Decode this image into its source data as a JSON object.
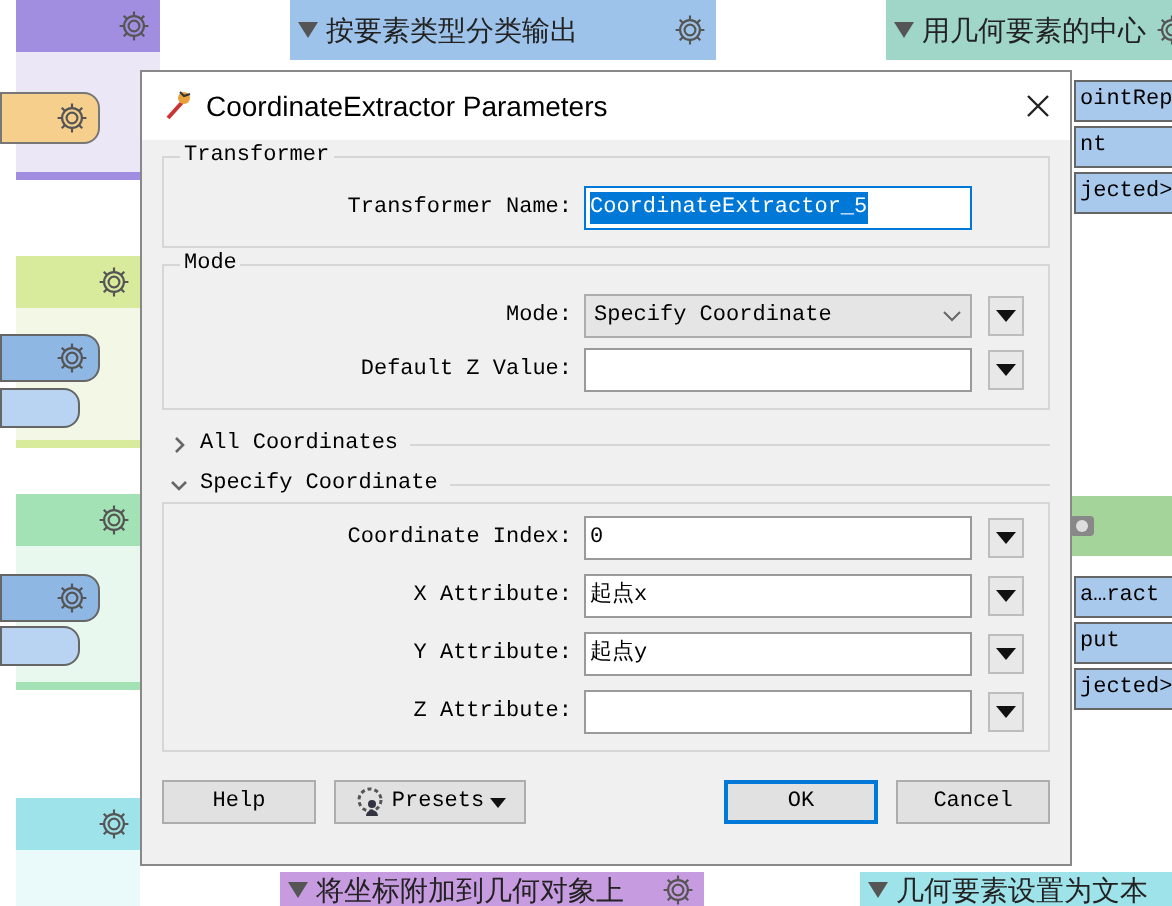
{
  "canvas": {
    "bookmarks": [
      {
        "title": "按要素类型分类输出",
        "color": "#9ec3ea"
      },
      {
        "title": "用几何要素的中心",
        "color": "#9fd6c8"
      },
      {
        "title": "将坐标附加到几何对象上",
        "color": "#c79be0"
      },
      {
        "title": "几何要素设置为文本",
        "color": "#9fe3ea"
      }
    ],
    "upper_ports": [
      {
        "text": "ointRep"
      },
      {
        "text": "nt"
      },
      {
        "text": "jected>"
      }
    ],
    "lower_ports": [
      {
        "text": "a…ract"
      },
      {
        "text": "put"
      },
      {
        "text": "jected>"
      }
    ]
  },
  "dialog": {
    "title": "CoordinateExtractor Parameters",
    "groups": [
      {
        "legend": "Transformer",
        "fields": [
          {
            "label": "Transformer Name:",
            "value": "CoordinateExtractor_5",
            "kind": "name",
            "selected": true
          }
        ]
      },
      {
        "legend": "Mode",
        "fields": [
          {
            "label": "Mode:",
            "value": "Specify Coordinate",
            "kind": "select"
          },
          {
            "label": "Default Z Value:",
            "kind": "input"
          }
        ]
      }
    ],
    "sections": [
      {
        "title": "All Coordinates",
        "expanded": false
      },
      {
        "title": "Specify Coordinate",
        "expanded": true,
        "fields": [
          {
            "label": "Coordinate Index:",
            "value": "0",
            "kind": "input"
          },
          {
            "label": "X Attribute:",
            "value": "起点x",
            "kind": "input"
          },
          {
            "label": "Y Attribute:",
            "value": "起点y",
            "kind": "input"
          },
          {
            "label": "Z Attribute:",
            "kind": "input"
          }
        ]
      }
    ],
    "buttons": [
      {
        "label": "Help",
        "kind": "plain"
      },
      {
        "label": "Presets",
        "kind": "presets"
      },
      {
        "label": "OK",
        "kind": "default"
      },
      {
        "label": "Cancel",
        "kind": "plain"
      }
    ]
  }
}
